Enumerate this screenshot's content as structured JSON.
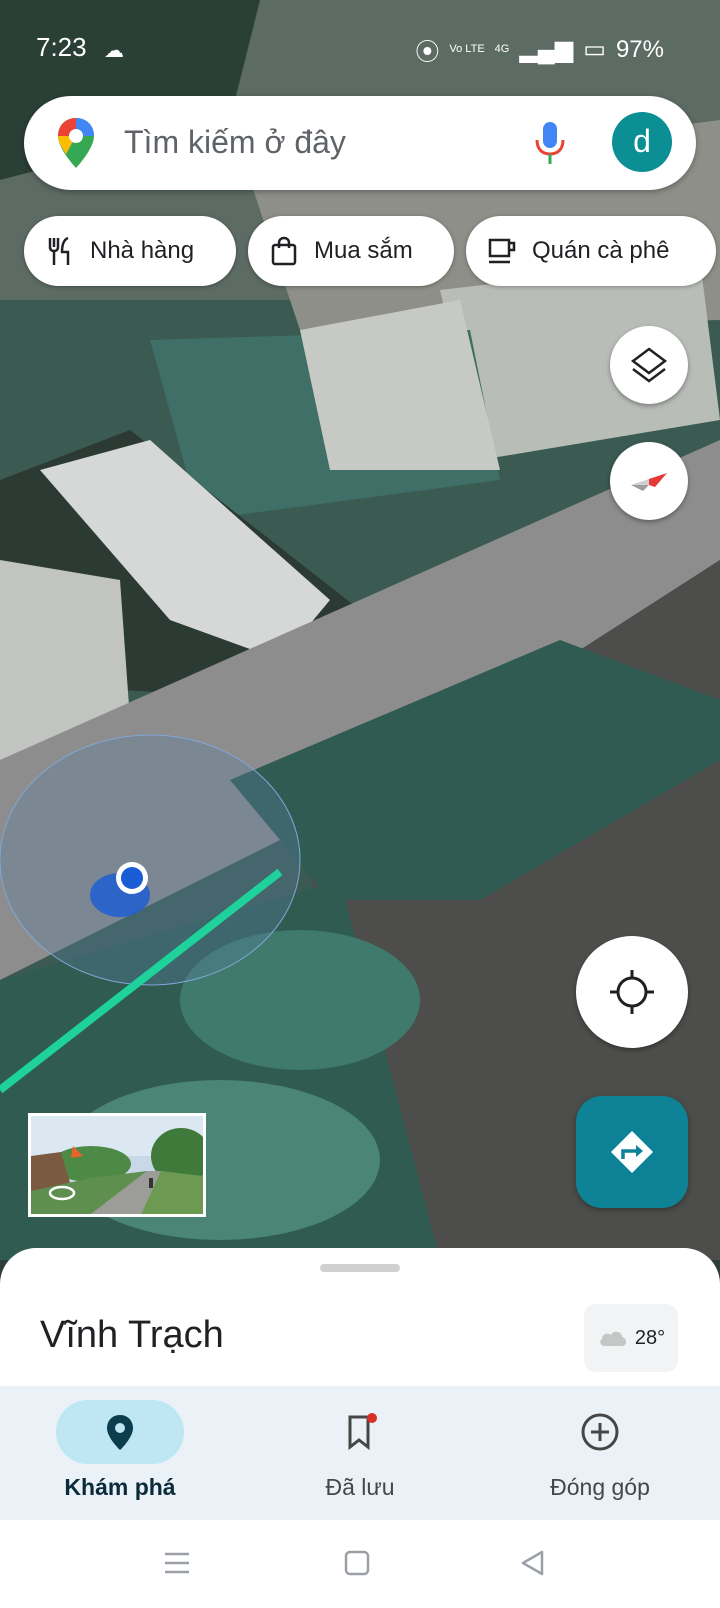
{
  "status_bar": {
    "time": "7:23",
    "network_label": "Vo LTE",
    "signal_label": "4G",
    "battery": "97%"
  },
  "search": {
    "placeholder": "Tìm kiếm ở đây",
    "avatar_letter": "d"
  },
  "chips": [
    {
      "label": "Nhà hàng",
      "icon": "restaurant-icon"
    },
    {
      "label": "Mua sắm",
      "icon": "shopping-bag-icon"
    },
    {
      "label": "Quán cà phê",
      "icon": "coffee-cup-icon"
    }
  ],
  "map_controls": [
    "layers-icon",
    "compass-icon",
    "my-location-icon",
    "directions-icon"
  ],
  "bottom_sheet": {
    "place_name": "Vĩnh Trạch",
    "temperature": "28°",
    "weather_icon": "cloud-icon"
  },
  "nav": [
    {
      "label": "Khám phá",
      "icon": "explore-pin-icon",
      "active": true
    },
    {
      "label": "Đã lưu",
      "icon": "bookmark-icon",
      "active": false
    },
    {
      "label": "Đóng góp",
      "icon": "add-circle-icon",
      "active": false
    }
  ],
  "colors": {
    "accent": "#0e8398",
    "route": "#1fd19a",
    "location_dot": "#1a5bd6"
  }
}
